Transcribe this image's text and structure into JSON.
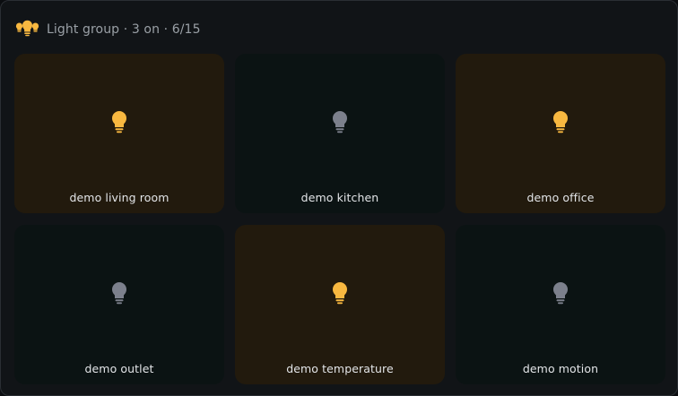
{
  "colors": {
    "on_icon": "#f8b840",
    "off_icon": "#7c808c",
    "on_tile": "#221a0d",
    "off_tile": "#0b1313",
    "header_icon": "#f8b840"
  },
  "header": {
    "icon": "multiple-bulbs-icon",
    "title": "Light group",
    "on_count_text": "3 on",
    "ratio_text": "6/15",
    "separator": "·"
  },
  "tiles": [
    {
      "name": "demo living room",
      "state": "on",
      "icon": "bulb-on-icon"
    },
    {
      "name": "demo kitchen",
      "state": "off",
      "icon": "bulb-off-icon"
    },
    {
      "name": "demo office",
      "state": "on",
      "icon": "bulb-on-icon"
    },
    {
      "name": "demo outlet",
      "state": "off",
      "icon": "bulb-off-icon"
    },
    {
      "name": "demo temperature",
      "state": "on",
      "icon": "bulb-on-icon"
    },
    {
      "name": "demo motion",
      "state": "off",
      "icon": "bulb-off-icon"
    }
  ]
}
